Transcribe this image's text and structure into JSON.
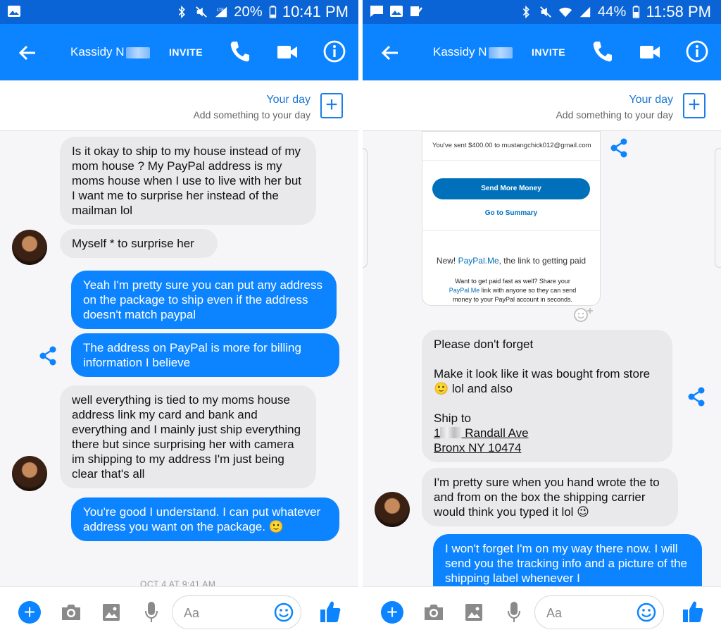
{
  "left": {
    "status": {
      "battery": "20%",
      "time": "10:41 PM",
      "network": "LTE"
    },
    "header": {
      "contact": "Kassidy N",
      "invite": "INVITE"
    },
    "yourday": {
      "title": "Your day",
      "subtitle": "Add something to your day"
    },
    "messages": [
      {
        "dir": "in",
        "text": "Is it okay to ship to my house instead of my mom house ? My PayPal address is my moms house when I use to live with her but I want me to surprise her instead of the mailman lol"
      },
      {
        "dir": "in",
        "text": "Myself * to surprise her"
      },
      {
        "dir": "out",
        "text": "Yeah I'm pretty sure you can put any address on the package to ship even if the address doesn't match paypal"
      },
      {
        "dir": "out",
        "text": "The address on PayPal is more for billing information I believe"
      },
      {
        "dir": "in",
        "text": "well everything is tied to my moms house address link my card and bank and everything and I mainly just ship everything there but since surprising her with camera im shipping to my address I'm just being clear that's all"
      },
      {
        "dir": "out",
        "text": "You're good I understand. I can put whatever address you want on the package. 🙂"
      }
    ],
    "date_separator": "OCT 4 AT 9:41 AM",
    "composer": {
      "placeholder": "Aa"
    }
  },
  "right": {
    "status": {
      "battery": "44%",
      "time": "11:58 PM"
    },
    "header": {
      "contact": "Kassidy N",
      "invite": "INVITE"
    },
    "yourday": {
      "title": "Your day",
      "subtitle": "Add something to your day"
    },
    "paypal": {
      "sent": "You've sent $400.00 to mustangchick012@gmail.com",
      "button": "Send More Money",
      "summary": "Go to Summary",
      "new_prefix": "New! ",
      "new_brand": "PayPal.Me",
      "new_suffix": ", the link to getting paid",
      "promo_a": "Want to get paid fast as well? Share your ",
      "promo_brand": "PayPal.Me",
      "promo_b": " link with anyone so they can send money to your PayPal account in seconds."
    },
    "messages": [
      {
        "dir": "in",
        "p1": "Please don't forget",
        "p2a": "Make it look like it was bought from store ",
        "p2b": " lol and also",
        "p3": "Ship to",
        "addr1a": "1",
        "addr1b": " Randall Ave ",
        "addr2": "Bronx NY 10474"
      },
      {
        "dir": "in",
        "text": "I'm pretty sure when you hand wrote the to and from on the box the shipping carrier would think you typed it lol 😉"
      },
      {
        "dir": "out",
        "text": "I won't forget I'm on my way there now. I will send you the tracking info and a picture of the shipping label whenever I"
      }
    ],
    "composer": {
      "placeholder": "Aa"
    }
  },
  "colors": {
    "messenger_blue": "#0d84ff",
    "statusbar": "#0a64d6",
    "incoming_bubble": "#e9e9eb",
    "paypal_blue": "#0070ba"
  }
}
